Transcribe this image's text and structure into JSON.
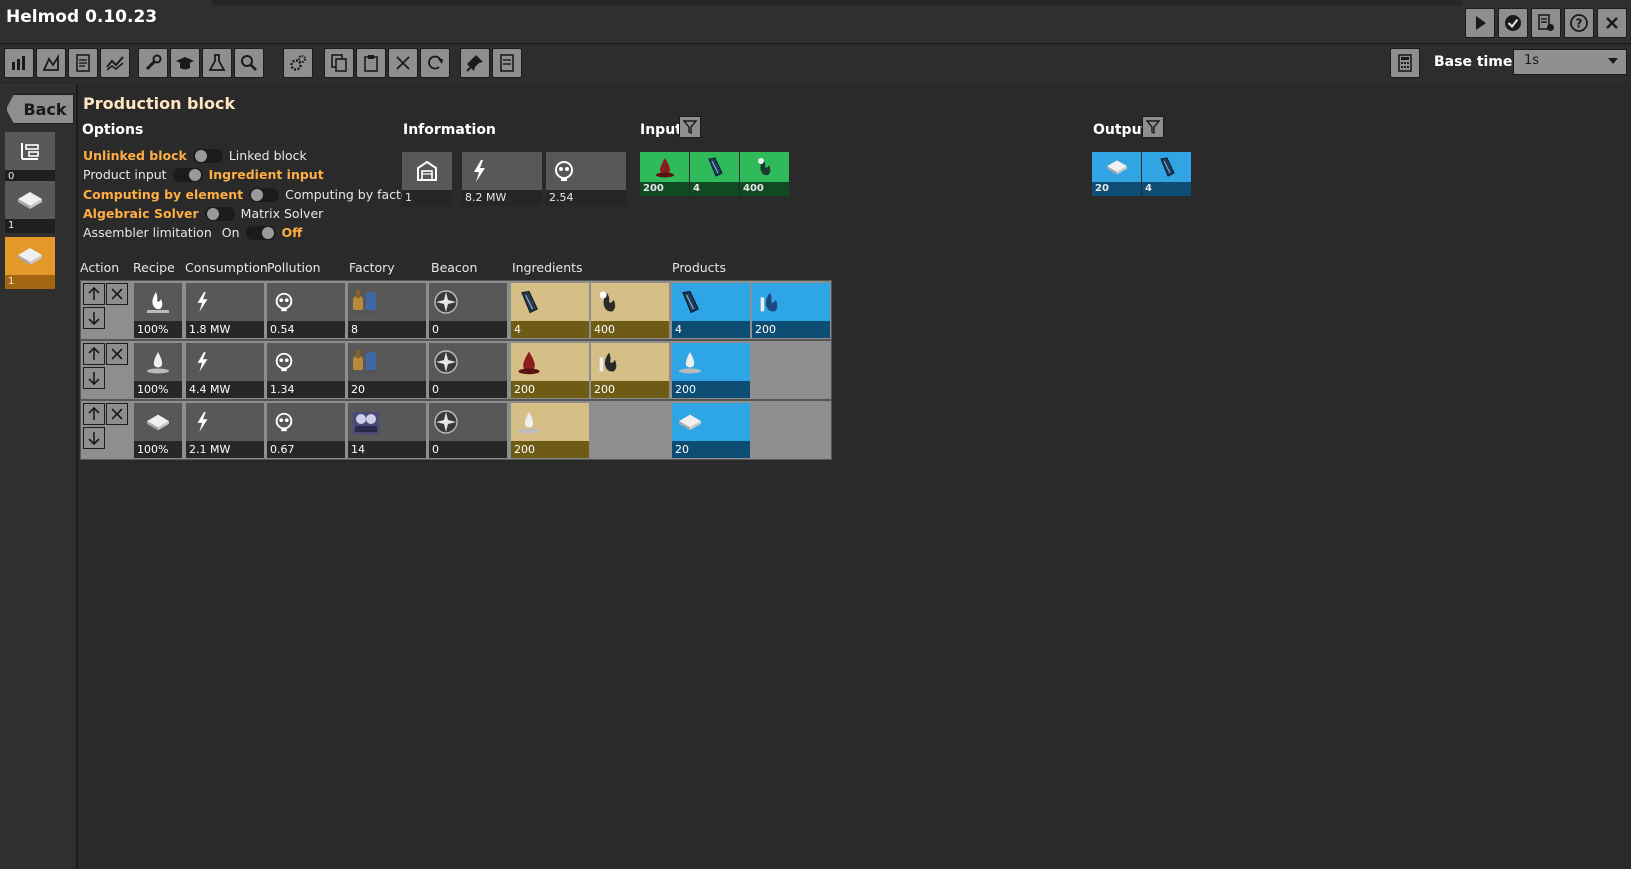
{
  "app": {
    "title": "Helmod 0.10.23"
  },
  "title_buttons": [
    {
      "name": "play-icon"
    },
    {
      "name": "check-icon"
    },
    {
      "name": "settings-list-icon"
    },
    {
      "name": "help-icon"
    },
    {
      "name": "close-icon"
    }
  ],
  "toolbar": {
    "base_time_label": "Base time:",
    "base_time_value": "1s"
  },
  "sidebar": {
    "back_label": "Back",
    "items": [
      {
        "count": "0",
        "icon": "production-line-icon"
      },
      {
        "count": "1",
        "icon": "plastic-bar-icon"
      },
      {
        "count": "1",
        "icon": "plastic-bar-icon"
      }
    ]
  },
  "main": {
    "title": "Production block",
    "options": {
      "title": "Options",
      "rows": [
        {
          "left": "Unlinked block",
          "right": "Linked block"
        },
        {
          "left": "Product input",
          "right": "Ingredient input"
        },
        {
          "left": "Computing by element",
          "right": "Computing by factory"
        },
        {
          "left": "Algebraic Solver",
          "right": "Matrix Solver"
        },
        {
          "label": "Assembler limitation",
          "left": "On",
          "right": "Off"
        }
      ]
    },
    "information": {
      "title": "Information",
      "cells": [
        {
          "icon": "factory-icon",
          "value": "1"
        },
        {
          "icon": "energy-icon",
          "value": "8.2 MW"
        },
        {
          "icon": "pollution-icon",
          "value": "2.54"
        }
      ]
    },
    "input": {
      "title": "Input",
      "items": [
        {
          "icon": "crude-oil-icon",
          "value": "200"
        },
        {
          "icon": "coal-icon",
          "value": "4"
        },
        {
          "icon": "petroleum-gas-icon",
          "value": "400"
        }
      ]
    },
    "output": {
      "title": "Output",
      "items": [
        {
          "icon": "plastic-bar-icon",
          "value": "20"
        },
        {
          "icon": "coal-icon",
          "value": "4"
        }
      ]
    },
    "table": {
      "headers": [
        "Action",
        "Recipe",
        "Consumption",
        "Pollution",
        "Factory",
        "Beacon",
        "Ingredients",
        "Products"
      ],
      "rows": [
        {
          "recipe": "100%",
          "consumption": "1.8 MW",
          "pollution": "0.54",
          "factory": "8",
          "beacon": "0",
          "ingredients": [
            "4",
            "400"
          ],
          "products": [
            "4",
            "200"
          ]
        },
        {
          "recipe": "100%",
          "consumption": "4.4 MW",
          "pollution": "1.34",
          "factory": "20",
          "beacon": "0",
          "ingredients": [
            "200",
            "200"
          ],
          "products": [
            "200"
          ]
        },
        {
          "recipe": "100%",
          "consumption": "2.1 MW",
          "pollution": "0.67",
          "factory": "14",
          "beacon": "0",
          "ingredients": [
            "200"
          ],
          "products": [
            "20"
          ]
        }
      ]
    }
  }
}
